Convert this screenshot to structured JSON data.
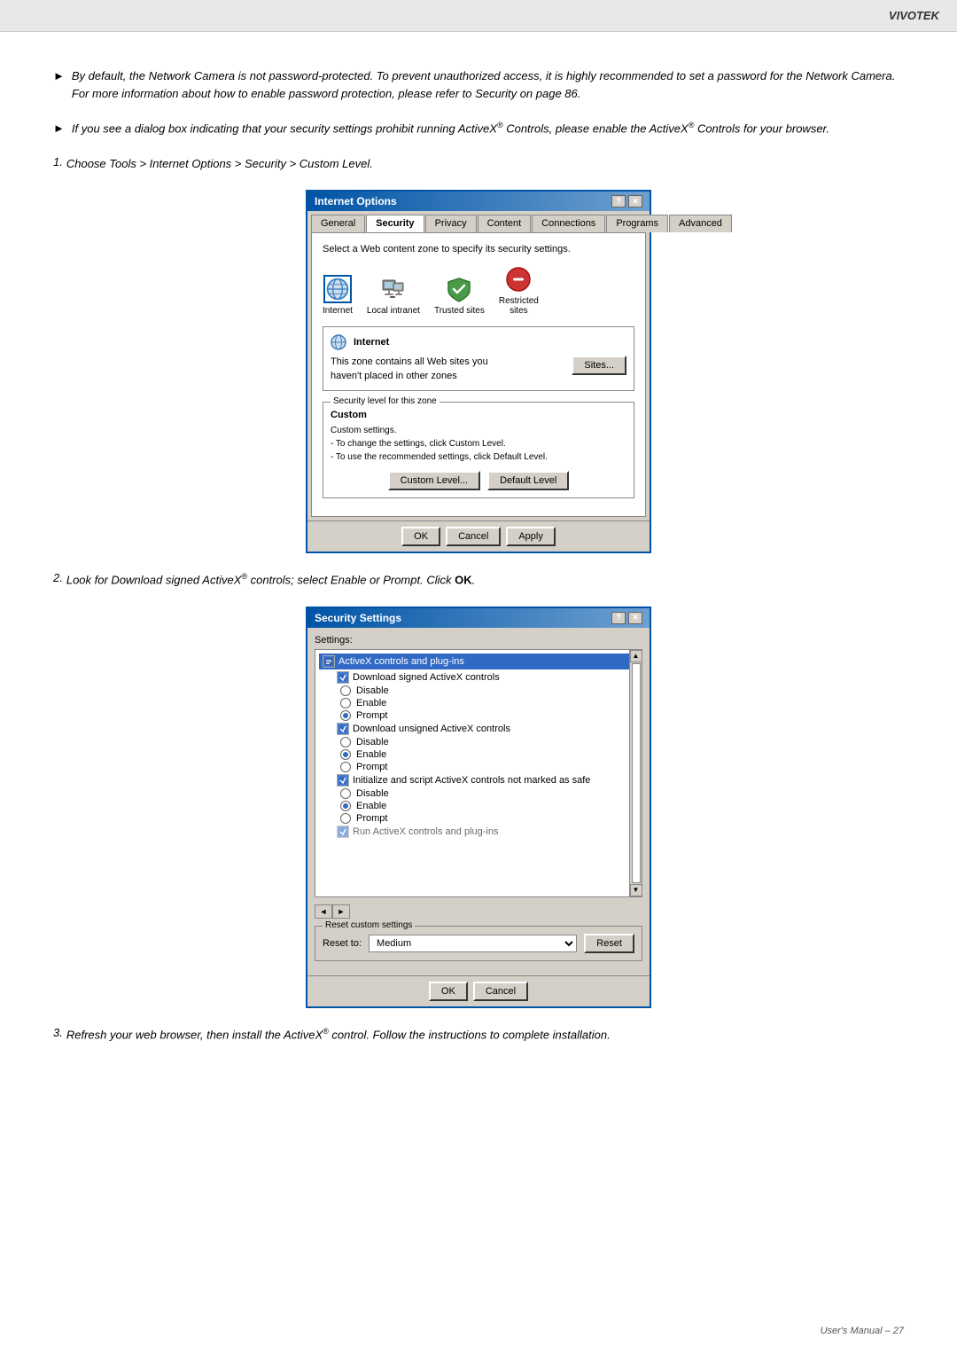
{
  "brand": "VIVOTEK",
  "page_number": "User's Manual – 27",
  "bullets": [
    {
      "id": "bullet1",
      "text": "By default, the Network Camera is not password-protected. To prevent unauthorized access, it is highly recommended to set a password for the Network Camera.\nFor more information about how to enable password protection, please refer to Security on page 86."
    },
    {
      "id": "bullet2",
      "text": "If you see a dialog box indicating that your security settings prohibit running ActiveX® Controls, please enable the ActiveX® Controls for your browser."
    }
  ],
  "steps": [
    {
      "number": "1.",
      "text": "Choose Tools > Internet Options > Security > Custom Level."
    },
    {
      "number": "2.",
      "text": "Look for Download signed ActiveX® controls; select Enable or Prompt. Click OK."
    },
    {
      "number": "3.",
      "text": "Refresh your web browser, then install the ActiveX® control. Follow the instructions to complete installation."
    }
  ],
  "inet_dialog": {
    "title": "Internet Options",
    "tabs": [
      "General",
      "Security",
      "Privacy",
      "Content",
      "Connections",
      "Programs",
      "Advanced"
    ],
    "active_tab": "Security",
    "description": "Select a Web content zone to specify its security settings.",
    "zones": [
      {
        "id": "internet",
        "label": "Internet",
        "selected": true
      },
      {
        "id": "local",
        "label": "Local intranet"
      },
      {
        "id": "trusted",
        "label": "Trusted sites"
      },
      {
        "id": "restricted",
        "label": "Restricted sites"
      }
    ],
    "zone_detail": {
      "name": "Internet",
      "icon": "globe",
      "text": "This zone contains all Web sites you haven't placed in other zones",
      "sites_button": "Sites..."
    },
    "security_group_label": "Security level for this zone",
    "security_custom_title": "Custom",
    "security_custom_lines": [
      "Custom settings.",
      "- To change the settings, click Custom Level.",
      "- To use the recommended settings, click Default Level."
    ],
    "buttons": {
      "custom_level": "Custom Level...",
      "default_level": "Default Level"
    },
    "footer": {
      "ok": "OK",
      "cancel": "Cancel",
      "apply": "Apply"
    }
  },
  "sec_dialog": {
    "title": "Security Settings",
    "settings_label": "Settings:",
    "categories": [
      {
        "name": "ActiveX controls and plug-ins",
        "highlighted": true,
        "subcategories": [
          {
            "name": "Download signed ActiveX controls",
            "options": [
              {
                "label": "Disable",
                "selected": false
              },
              {
                "label": "Enable",
                "selected": false
              },
              {
                "label": "Prompt",
                "selected": true
              }
            ]
          },
          {
            "name": "Download unsigned ActiveX controls",
            "options": [
              {
                "label": "Disable",
                "selected": false
              },
              {
                "label": "Enable",
                "selected": true
              },
              {
                "label": "Prompt",
                "selected": false
              }
            ]
          },
          {
            "name": "Initialize and script ActiveX controls not marked as safe",
            "options": [
              {
                "label": "Disable",
                "selected": false
              },
              {
                "label": "Enable",
                "selected": true
              },
              {
                "label": "Prompt",
                "selected": false
              }
            ]
          },
          {
            "name": "Run ActiveX controls and plug-ins",
            "partial": true
          }
        ]
      }
    ],
    "reset_group_label": "Reset custom settings",
    "reset_label": "Reset to:",
    "reset_value": "Medium",
    "reset_button": "Reset",
    "footer": {
      "ok": "OK",
      "cancel": "Cancel"
    }
  }
}
